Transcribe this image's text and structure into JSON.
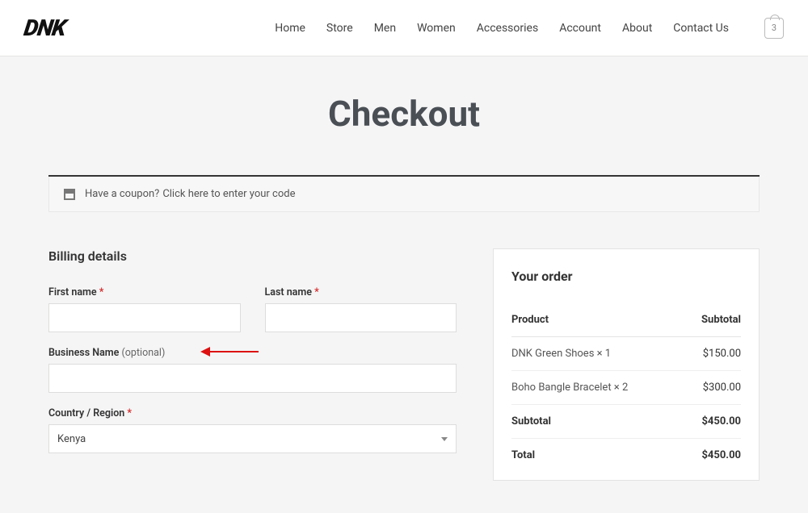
{
  "header": {
    "logo": "DNK",
    "nav": [
      "Home",
      "Store",
      "Men",
      "Women",
      "Accessories",
      "Account",
      "About",
      "Contact Us"
    ],
    "cart_count": "3"
  },
  "page": {
    "title": "Checkout"
  },
  "coupon": {
    "text": "Have a coupon?",
    "link": "Click here to enter your code"
  },
  "billing": {
    "heading": "Billing details",
    "first_name_label": "First name",
    "last_name_label": "Last name",
    "business_label": "Business Name",
    "business_opt": "(optional)",
    "country_label": "Country / Region",
    "country_value": "Kenya",
    "required_mark": "*"
  },
  "order": {
    "heading": "Your order",
    "product_h": "Product",
    "subtotal_h": "Subtotal",
    "items": [
      {
        "name": "DNK Green Shoes  × 1",
        "price": "$150.00"
      },
      {
        "name": "Boho Bangle Bracelet  × 2",
        "price": "$300.00"
      }
    ],
    "subtotal_label": "Subtotal",
    "subtotal": "$450.00",
    "total_label": "Total",
    "total": "$450.00"
  }
}
